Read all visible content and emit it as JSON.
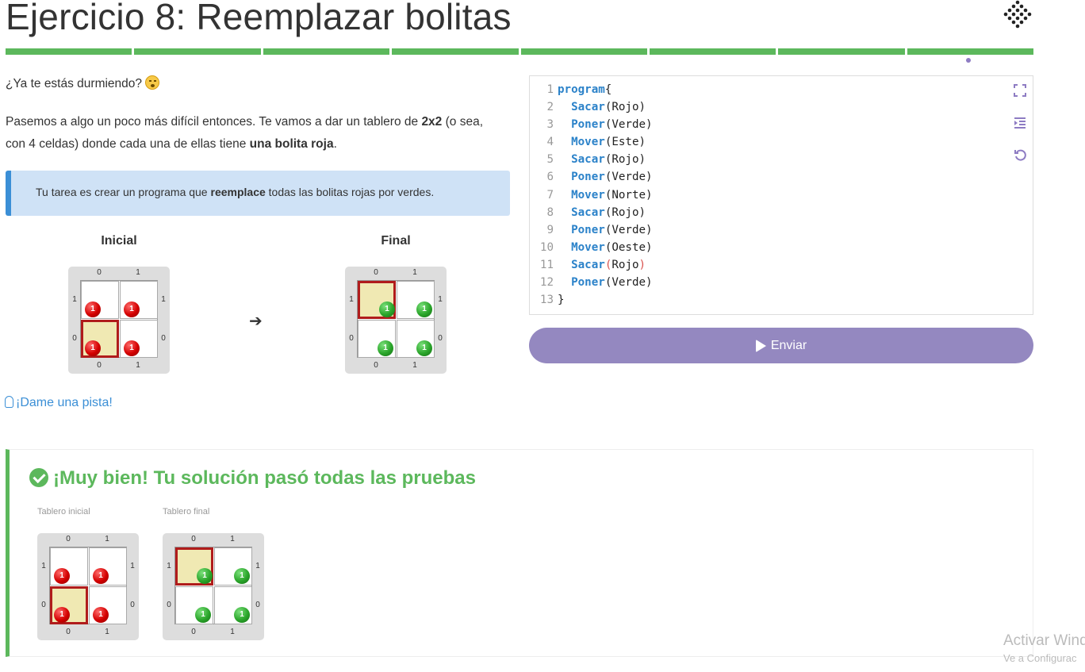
{
  "header": {
    "title": "Ejercicio 8: Reemplazar bolitas",
    "progress_segments": 8
  },
  "statement": {
    "question": "¿Ya te estás durmiendo?",
    "p1_before": "Pasemos a algo un poco más difícil entonces. Te vamos a dar un tablero de ",
    "p1_bold1": "2x2",
    "p1_mid": " (o sea,",
    "p1_line2": "con 4 celdas) donde cada una de ellas tiene ",
    "p1_bold2": "una bolita roja",
    "p1_end": ".",
    "callout_before": "Tu tarea es crear un programa que ",
    "callout_bold": "reemplace",
    "callout_after": " todas las bolitas rojas por verdes."
  },
  "boards": {
    "initial_label": "Inicial",
    "final_label": "Final",
    "arrow": "➔",
    "col_labels": [
      "0",
      "1"
    ],
    "row_labels": [
      "1",
      "0"
    ],
    "ball_count": "1"
  },
  "hint": {
    "label": "¡Dame una pista!"
  },
  "editor": {
    "line_numbers": [
      "1",
      "2",
      "3",
      "4",
      "5",
      "6",
      "7",
      "8",
      "9",
      "10",
      "11",
      "12",
      "13"
    ],
    "lines": [
      {
        "kw": "program",
        "rest": "{"
      },
      {
        "indent": "  ",
        "proc": "Sacar",
        "rest": "(Rojo)"
      },
      {
        "indent": "  ",
        "proc": "Poner",
        "rest": "(Verde)"
      },
      {
        "indent": "  ",
        "proc": "Mover",
        "rest": "(Este)"
      },
      {
        "indent": "  ",
        "proc": "Sacar",
        "rest": "(Rojo)"
      },
      {
        "indent": "  ",
        "proc": "Poner",
        "rest": "(Verde)"
      },
      {
        "indent": "  ",
        "proc": "Mover",
        "rest": "(Norte)"
      },
      {
        "indent": "  ",
        "proc": "Sacar",
        "rest": "(Rojo)"
      },
      {
        "indent": "  ",
        "proc": "Poner",
        "rest": "(Verde)"
      },
      {
        "indent": "  ",
        "proc": "Mover",
        "rest": "(Oeste)"
      },
      {
        "indent": "  ",
        "proc": "Sacar",
        "rest": "(Rojo)"
      },
      {
        "indent": "  ",
        "proc": "Poner",
        "rest": "(Verde)"
      },
      {
        "kw": "",
        "rest": "}"
      }
    ],
    "submit_label": "Enviar"
  },
  "result": {
    "title": "¡Muy bien! Tu solución pasó todas las pruebas",
    "initial_label": "Tablero inicial",
    "final_label": "Tablero final"
  },
  "watermark": {
    "line1": "Activar Wind",
    "line2": "Ve a Configurac"
  },
  "colors": {
    "progress": "#5cb85c",
    "accent": "#9488c0",
    "success": "#5cb85c",
    "callout_bg": "#cfe2f6",
    "link": "#3b8fd6"
  }
}
